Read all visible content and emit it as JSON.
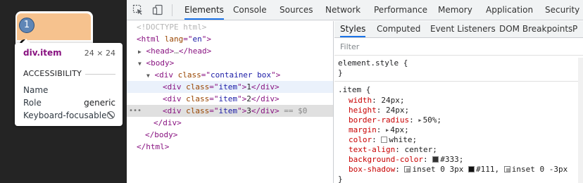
{
  "preview": {
    "item_number": "1",
    "tooltip": {
      "tag": "div.item",
      "dims": "24 × 24",
      "section": "ACCESSIBILITY",
      "rows": [
        {
          "label": "Name",
          "value": ""
        },
        {
          "label": "Role",
          "value": "generic"
        },
        {
          "label": "Keyboard-focusable",
          "value": ""
        }
      ]
    }
  },
  "topbar": {
    "tabs": [
      "Elements",
      "Console",
      "Sources",
      "Network",
      "Performance",
      "Memory",
      "Application",
      "Security"
    ],
    "active_tab": "Elements"
  },
  "tree": {
    "lines": [
      {
        "c": "<!DOCTYPE html>"
      },
      {
        "open": "html",
        "attr": "lang",
        "val": "en"
      },
      {
        "t": "head",
        "collapsed": "…"
      },
      {
        "t": "body"
      },
      {
        "open": "div",
        "attr": "class",
        "val": "container box"
      },
      {
        "open": "div",
        "attr": "class",
        "val": "item",
        "text": "1"
      },
      {
        "open": "div",
        "attr": "class",
        "val": "item",
        "text": "2"
      },
      {
        "open": "div",
        "attr": "class",
        "val": "item",
        "text": "3",
        "suffix": "== $0"
      },
      {
        "close": "div"
      },
      {
        "close": "body"
      },
      {
        "close": "html"
      }
    ]
  },
  "styles": {
    "tabs": [
      "Styles",
      "Computed",
      "Event Listeners",
      "DOM Breakpoints",
      "P"
    ],
    "active_tab": "Styles",
    "filter_placeholder": "Filter",
    "element_style": "element.style {",
    "close_brace": "}",
    "rule_selector": ".item {",
    "declarations": [
      {
        "name": "width",
        "value": "24px;"
      },
      {
        "name": "height",
        "value": "24px;"
      },
      {
        "name": "border-radius",
        "value": "50%;"
      },
      {
        "name": "margin",
        "value": "4px;"
      },
      {
        "name": "color",
        "value": "white;"
      },
      {
        "name": "text-align",
        "value": "center;"
      },
      {
        "name": "background-color",
        "value": "#333;"
      },
      {
        "name": "box-shadow",
        "value": "inset 0 3px",
        "value2": "#111,",
        "value3": "inset 0 -3px"
      }
    ],
    "colors": {
      "white_swatch": "#ffffff",
      "bg_swatch": "#333333",
      "shadow_swatch": "#111111"
    }
  }
}
